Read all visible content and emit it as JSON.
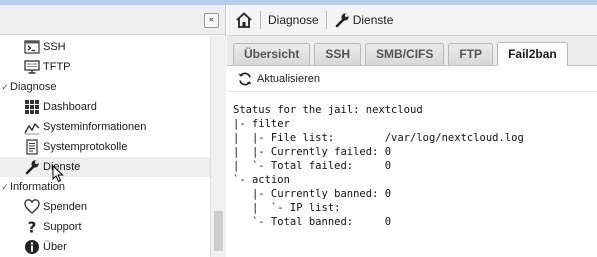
{
  "sidebar": {
    "collapse_glyph": "«",
    "tree": [
      {
        "kind": "leaf",
        "label": "SSH",
        "icon": "terminal-icon"
      },
      {
        "kind": "leaf",
        "label": "TFTP",
        "icon": "monitor-icon"
      },
      {
        "kind": "group",
        "label": "Diagnose",
        "expanded": true
      },
      {
        "kind": "leaf",
        "label": "Dashboard",
        "icon": "grid-icon"
      },
      {
        "kind": "leaf",
        "label": "Systeminformationen",
        "icon": "chart-line-icon"
      },
      {
        "kind": "leaf",
        "label": "Systemprotokolle",
        "icon": "document-icon"
      },
      {
        "kind": "leaf",
        "label": "Dienste",
        "icon": "wrench-icon",
        "hovered": true
      },
      {
        "kind": "group",
        "label": "Information",
        "expanded": true
      },
      {
        "kind": "leaf",
        "label": "Spenden",
        "icon": "heart-icon"
      },
      {
        "kind": "leaf",
        "label": "Support",
        "icon": "question-icon"
      },
      {
        "kind": "leaf",
        "label": "Über",
        "icon": "info-icon"
      }
    ]
  },
  "breadcrumb": {
    "section": "Diagnose",
    "page": "Dienste"
  },
  "tabs": [
    {
      "label": "Übersicht",
      "active": false
    },
    {
      "label": "SSH",
      "active": false
    },
    {
      "label": "SMB/CIFS",
      "active": false
    },
    {
      "label": "FTP",
      "active": false
    },
    {
      "label": "Fail2ban",
      "active": true
    }
  ],
  "toolbar": {
    "refresh_label": "Aktualisieren"
  },
  "output": [
    "Status for the jail: nextcloud",
    "|- filter",
    "|  |- File list:        /var/log/nextcloud.log",
    "|  |- Currently failed: 0",
    "|  `- Total failed:     0",
    "`- action",
    "   |- Currently banned: 0",
    "   |  `- IP list:",
    "   `- Total banned:     0"
  ],
  "colors": {
    "topbar": "#b5cde6",
    "panel_bg": "#eeeeee",
    "hover_row": "#eeeeee",
    "text": "#1a1a1a"
  }
}
